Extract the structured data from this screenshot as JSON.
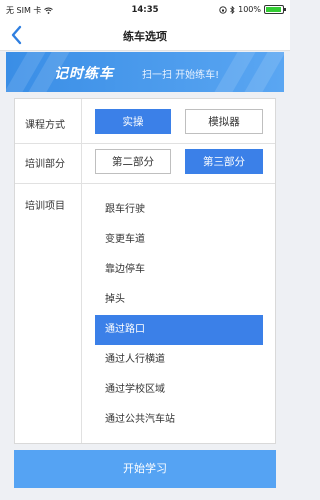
{
  "status": {
    "carrier": "无 SIM 卡",
    "time": "14:35",
    "battery": "100%"
  },
  "nav": {
    "title": "练车选项"
  },
  "banner": {
    "title": "记时练车",
    "subtitle": "扫一扫  开始练车!"
  },
  "course_mode": {
    "label": "课程方式",
    "options": [
      "实操",
      "模拟器"
    ],
    "selected": "实操"
  },
  "training_part": {
    "label": "培训部分",
    "options": [
      "第二部分",
      "第三部分"
    ],
    "selected": "第三部分"
  },
  "training_items": {
    "label": "培训项目",
    "items": [
      "跟车行驶",
      "变更车道",
      "靠边停车",
      "掉头",
      "通过路口",
      "通过人行横道",
      "通过学校区域",
      "通过公共汽车站"
    ],
    "selected": "通过路口"
  },
  "start_button": "开始学习",
  "colors": {
    "accent": "#3b80e8",
    "banner": "#4a9be9",
    "start": "#55a3f3"
  }
}
